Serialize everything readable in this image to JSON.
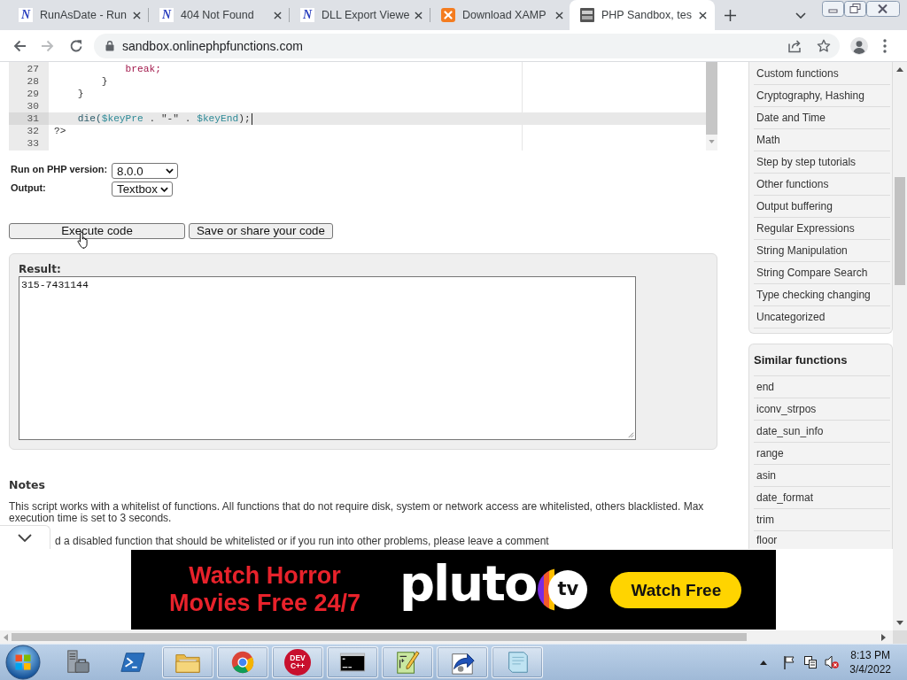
{
  "browser": {
    "tabs": [
      {
        "title": "RunAsDate - Run",
        "favicon": {
          "kind": "letter",
          "text": "N"
        },
        "selected": false
      },
      {
        "title": "404 Not Found",
        "favicon": {
          "kind": "letter",
          "text": "N"
        },
        "selected": false
      },
      {
        "title": "DLL Export Viewe",
        "favicon": {
          "kind": "letter",
          "text": "N"
        },
        "selected": false
      },
      {
        "title": "Download XAMP",
        "favicon": {
          "kind": "tile"
        },
        "selected": false
      },
      {
        "title": "PHP Sandbox, tes",
        "favicon": {
          "kind": "square"
        },
        "selected": true
      }
    ],
    "nav": [
      {
        "kind": "back",
        "disabled": false
      },
      {
        "kind": "forward",
        "disabled": true
      },
      {
        "kind": "reload",
        "disabled": false
      }
    ],
    "address": "sandbox.onlinephpfunctions.com"
  },
  "editor": {
    "lines": [
      {
        "number": "27",
        "active": false,
        "tokens": [
          {
            "text": "            break;",
            "kind": "keyword"
          }
        ]
      },
      {
        "number": "28",
        "active": false,
        "tokens": [
          {
            "text": "        }",
            "kind": "plain"
          }
        ]
      },
      {
        "number": "29",
        "active": false,
        "tokens": [
          {
            "text": "    }",
            "kind": "plain"
          }
        ]
      },
      {
        "number": "30",
        "active": false
      },
      {
        "number": "31",
        "active": true,
        "tokens": [
          {
            "text": "    die(",
            "kind": "func"
          },
          {
            "text": "$keyPre",
            "kind": "variable"
          },
          {
            "text": " . ",
            "kind": "plain"
          },
          {
            "text": "\"-\"",
            "kind": "string"
          },
          {
            "text": " . ",
            "kind": "plain"
          },
          {
            "text": "$keyEnd",
            "kind": "variable"
          },
          {
            "text": ");",
            "kind": "plain"
          }
        ]
      },
      {
        "number": "32",
        "active": false,
        "tokens": [
          {
            "text": "?>",
            "kind": "plain"
          }
        ]
      },
      {
        "number": "33",
        "active": false
      }
    ]
  },
  "settings": [
    {
      "label": "Run on PHP version:",
      "value": "8.0.0"
    },
    {
      "label": "Output:",
      "value": "Textbox"
    }
  ],
  "actions": [
    "Execute code",
    "Save or share your code"
  ],
  "result": {
    "label": "Result:",
    "output": "315-7431144"
  },
  "notes": {
    "title": "Notes",
    "paragraphs": [
      "This script works with a whitelist of functions. All functions that do not require disk, system or network access are whitelisted, others blacklisted. Max execution time is set to 3 seconds.",
      "d a disabled function that should be whitelisted or if you run into other problems, please leave a comment"
    ]
  },
  "sidebar": {
    "categories": [
      "Custom functions",
      "Cryptography, Hashing",
      "Date and Time",
      "Math",
      "Step by step tutorials",
      "Other functions",
      "Output buffering",
      "Regular Expressions",
      "String Manipulation",
      "String Compare Search",
      "Type checking changing",
      "Uncategorized"
    ],
    "similar": {
      "title": "Similar functions",
      "items": [
        "end",
        "iconv_strpos",
        "date_sun_info",
        "range",
        "asin",
        "date_format",
        "trim",
        "floor"
      ]
    }
  },
  "ad": {
    "headline": "Watch Horror Movies Free 24/7",
    "brand": "pluto",
    "brand_badge": "tv",
    "cta": "Watch Free"
  },
  "taskbar": {
    "apps": [
      {
        "kind": "server",
        "running": false
      },
      {
        "kind": "shell",
        "running": false
      },
      {
        "kind": "folder",
        "running": true
      },
      {
        "kind": "chrome",
        "running": true
      },
      {
        "kind": "devcpp",
        "running": true,
        "label": "DEV C++"
      },
      {
        "kind": "console",
        "running": true
      },
      {
        "kind": "editor",
        "running": true
      },
      {
        "kind": "installer",
        "running": true
      },
      {
        "kind": "notepad",
        "running": true
      }
    ],
    "tray": [
      {
        "kind": "expand"
      },
      {
        "kind": "flag"
      },
      {
        "kind": "network"
      }
    ],
    "volume": {
      "muted": true
    },
    "clock": {
      "time": "8:13 PM",
      "date": "3/4/2022"
    }
  }
}
